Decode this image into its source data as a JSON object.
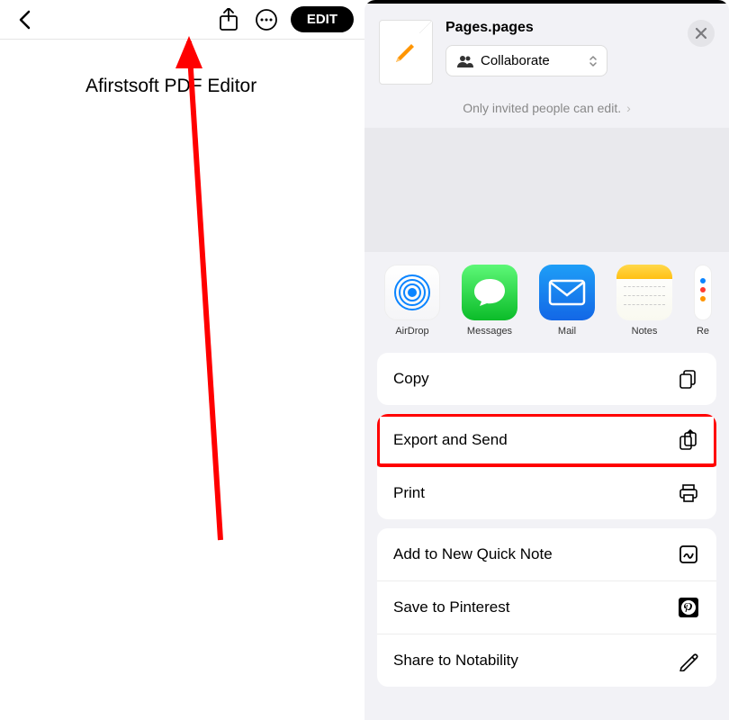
{
  "left": {
    "edit_label": "EDIT",
    "doc_title": "Afirstsoft PDF Editor"
  },
  "share_sheet": {
    "file_name": "Pages.pages",
    "collaborate_label": "Collaborate",
    "invite_note": "Only invited people can edit.",
    "apps": [
      {
        "name": "AirDrop"
      },
      {
        "name": "Messages"
      },
      {
        "name": "Mail"
      },
      {
        "name": "Notes"
      },
      {
        "name": "Re"
      }
    ],
    "actions_group1": [
      {
        "label": "Copy",
        "icon": "copy"
      }
    ],
    "actions_group2": [
      {
        "label": "Export and Send",
        "icon": "export"
      },
      {
        "label": "Print",
        "icon": "print"
      }
    ],
    "actions_group3": [
      {
        "label": "Add to New Quick Note",
        "icon": "quicknote"
      },
      {
        "label": "Save to Pinterest",
        "icon": "pinterest"
      },
      {
        "label": "Share to Notability",
        "icon": "notability"
      }
    ]
  }
}
